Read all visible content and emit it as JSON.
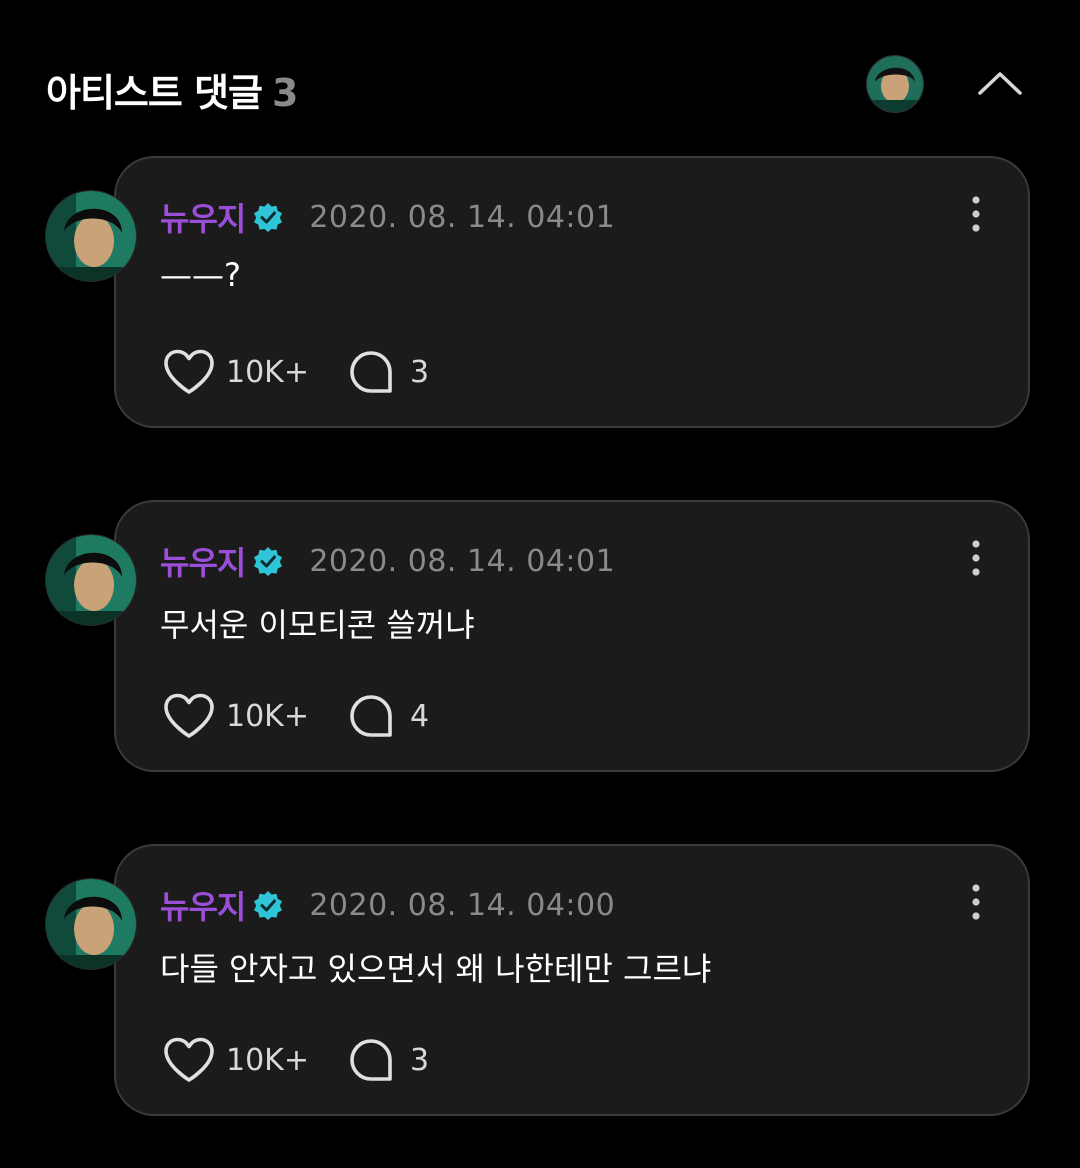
{
  "header": {
    "title": "아티스트 댓글",
    "count": "3"
  },
  "colors": {
    "background": "#000000",
    "card": "#1b1b1b",
    "card_border": "#3a3a3a",
    "author": "#9b4fd8",
    "verified": "#2fc4d6",
    "muted": "#8a8a8a"
  },
  "icons": {
    "collapse": "chevron-up-icon",
    "verified": "verified-badge-icon",
    "more": "more-vertical-icon",
    "like": "heart-icon",
    "reply": "speech-bubble-icon"
  },
  "comments": [
    {
      "author": "뉴우지",
      "timestamp": "2020. 08. 14. 04:01",
      "text": "——?",
      "likes": "10K+",
      "replies": "3"
    },
    {
      "author": "뉴우지",
      "timestamp": "2020. 08. 14. 04:01",
      "text": "무서운 이모티콘 쓸꺼냐",
      "likes": "10K+",
      "replies": "4"
    },
    {
      "author": "뉴우지",
      "timestamp": "2020. 08. 14. 04:00",
      "text": "다들 안자고 있으면서 왜 나한테만 그르냐",
      "likes": "10K+",
      "replies": "3"
    }
  ]
}
